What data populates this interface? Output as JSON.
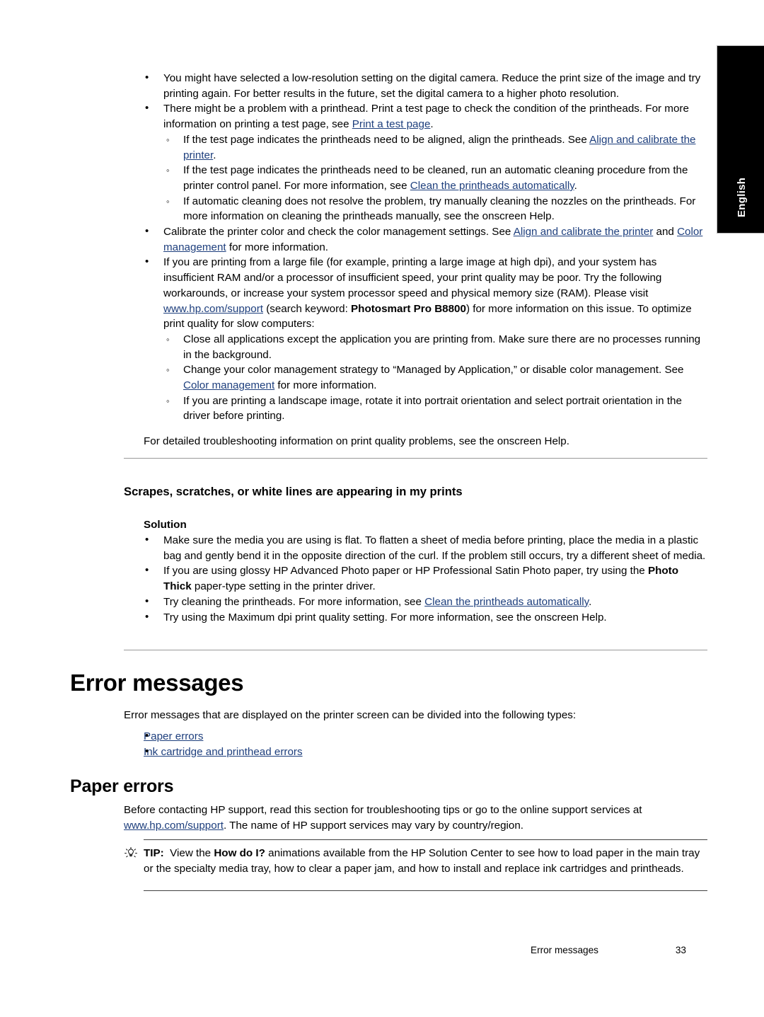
{
  "page": {
    "language_tab": "English",
    "footer": {
      "section": "Error messages",
      "page_number": "33"
    }
  },
  "colors": {
    "link": "#1e3f7d",
    "rule": "#999999",
    "tip_rule": "#404040",
    "tab_background": "#000000",
    "text": "#000000"
  },
  "blocks": {
    "bullet_camera": {
      "text": "You might have selected a low-resolution setting on the digital camera. Reduce the print size of the image and try printing again. For better results in the future, set the digital camera to a higher photo resolution."
    },
    "bullet_printhead": {
      "pre": "There might be a problem with a printhead. Print a test page to check the condition of the printheads. For more information on printing a test page, see ",
      "link": "Print a test page",
      "post": "."
    },
    "sub_align": {
      "pre": "If the test page indicates the printheads need to be aligned, align the printheads. See ",
      "link": "Align and calibrate the printer",
      "post": "."
    },
    "sub_clean": {
      "pre": "If the test page indicates the printheads need to be cleaned, run an automatic cleaning procedure from the printer control panel. For more information, see ",
      "link": "Clean the printheads automatically",
      "post": "."
    },
    "sub_manual": {
      "text": "If automatic cleaning does not resolve the problem, try manually cleaning the nozzles on the printheads. For more information on cleaning the printheads manually, see the onscreen Help."
    },
    "bullet_calibrate": {
      "pre": "Calibrate the printer color and check the color management settings. See ",
      "link1": "Align and calibrate the printer",
      "mid": " and ",
      "link2": "Color management",
      "post": " for more information."
    },
    "bullet_largefile": {
      "pre": "If you are printing from a large file (for example, printing a large image at high dpi), and your system has insufficient RAM and/or a processor of insufficient speed, your print quality may be poor. Try the following workarounds, or increase your system processor speed and physical memory size (RAM). Please visit ",
      "link": "www.hp.com/support",
      "mid": " (search keyword: ",
      "bold": "Photosmart Pro B8800",
      "post": ") for more information on this issue. To optimize print quality for slow computers:"
    },
    "sub_closeapps": {
      "text": "Close all applications except the application you are printing from. Make sure there are no processes running in the background."
    },
    "sub_colorstrategy": {
      "pre": "Change your color management strategy to “Managed by Application,” or disable color management. See ",
      "link": "Color management",
      "post": " for more information."
    },
    "sub_landscape": {
      "text": "If you are printing a landscape image, rotate it into portrait orientation and select portrait orientation in the driver before printing."
    },
    "detailed_troubleshooting": {
      "text": "For detailed troubleshooting information on print quality problems, see the onscreen Help."
    }
  },
  "section_scrapes": {
    "heading": "Scrapes, scratches, or white lines are appearing in my prints",
    "solution_label": "Solution",
    "bullets": {
      "flat_media": {
        "text": "Make sure the media you are using is flat. To flatten a sheet of media before printing, place the media in a plastic bag and gently bend it in the opposite direction of the curl. If the problem still occurs, try a different sheet of media."
      },
      "glossy_paper": {
        "pre": "If you are using glossy HP Advanced Photo paper or HP Professional Satin Photo paper, try using the ",
        "bold": "Photo Thick",
        "post": " paper-type setting in the printer driver."
      },
      "clean_printheads": {
        "pre": "Try cleaning the printheads. For more information, see ",
        "link": "Clean the printheads automatically",
        "post": "."
      },
      "max_dpi": {
        "text": "Try using the Maximum dpi print quality setting. For more information, see the onscreen Help."
      }
    }
  },
  "section_error_messages": {
    "heading": "Error messages",
    "intro": "Error messages that are displayed on the printer screen can be divided into the following types:",
    "links": [
      "Paper errors",
      "Ink cartridge and printhead errors"
    ]
  },
  "section_paper_errors": {
    "heading": "Paper errors",
    "intro_pre": "Before contacting HP support, read this section for troubleshooting tips or go to the online support services at ",
    "intro_link": "www.hp.com/support",
    "intro_post": ". The name of HP support services may vary by country/region.",
    "tip": {
      "label": "TIP:",
      "pre": "View the ",
      "bold": "How do I?",
      "post": " animations available from the HP Solution Center to see how to load paper in the main tray or the specialty media tray, how to clear a paper jam, and how to install and replace ink cartridges and printheads."
    }
  }
}
